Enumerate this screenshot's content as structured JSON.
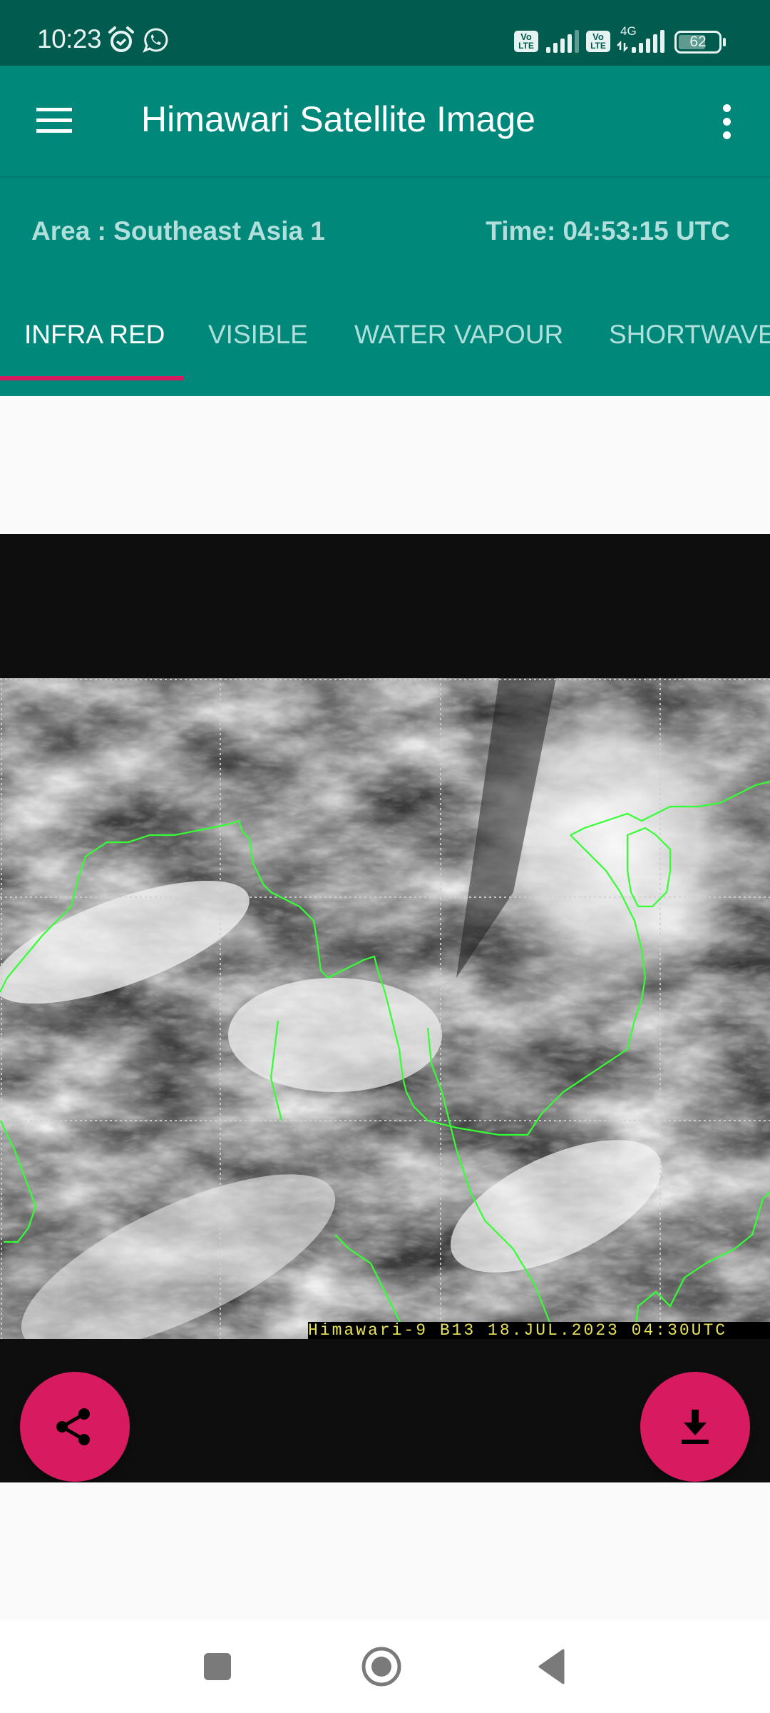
{
  "status_bar": {
    "time": "10:23",
    "left_icons": [
      "alarm-icon",
      "whatsapp-icon"
    ],
    "right_icons": [
      "volte-icon",
      "signal-icon",
      "volte-icon",
      "4g-signal-icon",
      "battery-icon"
    ],
    "network_label": "4G",
    "volte_label_top": "Vo",
    "volte_label_bottom": "LTE",
    "battery_level": "62"
  },
  "app_bar": {
    "title": "Himawari Satellite Image",
    "menu_icon": "hamburger-menu-icon",
    "overflow_icon": "more-vertical-icon"
  },
  "info": {
    "area": "Area : Southeast Asia 1",
    "time": "Time: 04:53:15 UTC"
  },
  "tabs": [
    {
      "label": "INFRA RED",
      "active": true
    },
    {
      "label": "VISIBLE",
      "active": false
    },
    {
      "label": "WATER VAPOUR",
      "active": false
    },
    {
      "label": "SHORTWAVE",
      "active": false
    }
  ],
  "satellite_image": {
    "caption": "Himawari-9 B13 18.JUL.2023 04:30UTC",
    "description": "Infrared satellite image of Southeast Asia with green coastlines"
  },
  "actions": {
    "share_icon": "share-icon",
    "download_icon": "download-icon"
  },
  "colors": {
    "primary": "#00897B",
    "primary_dark": "#025B4F",
    "accent": "#D81B60",
    "tab_inactive": "#B2DFDB",
    "coastline": "#33FF33",
    "caption_text": "#E8E35A"
  },
  "nav_bar": {
    "buttons": [
      "recents-icon",
      "home-icon",
      "back-icon"
    ]
  }
}
